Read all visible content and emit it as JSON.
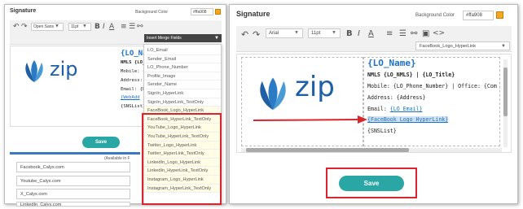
{
  "left": {
    "title": "Signature",
    "bg_label": "Background Color",
    "bg_value": "#ffa908",
    "toolbar": {
      "font": "Open Sans",
      "size": "11pt",
      "merge_label": "Insert Merge Fields"
    },
    "sig": {
      "name": "{LO_Nam",
      "nmls": "NMLS {LO_N",
      "mobile": "Mobile: {LO_",
      "address": "Address: {Ad",
      "email": "Email: {LO_",
      "web": "{WebAdd",
      "sns": "{SNSList}"
    },
    "dropdown_items": [
      "LO_Email",
      "Sender_Email",
      "LO_Phone_Number",
      "Profile_Image",
      "Sender_Name",
      "SignIn_HyperLink",
      "SignIn_HyperLink_TextOnly",
      "FaceBook_Logo_HyperLink",
      "FaceBook_HyperLink_TextOnly",
      "YouTube_Logo_HyperLink",
      "YouTube_HyperLink_TextOnly",
      "Twitter_Logo_HyperLink",
      "Twitter_HyperLink_TextOnly",
      "LinkedIn_Logo_HyperLink",
      "LinkedIn_HyperLink_TextOnly",
      "Instagram_Logo_HyperLink",
      "Instagram_HyperLink_TextOnly"
    ],
    "save": "Save",
    "available": "(Available in F",
    "social_fields": [
      "Facebook_Calyx.com",
      "Youtube_Calyx.com",
      "X_Calyx.com",
      "LinkedIn_Calyx.com"
    ]
  },
  "right": {
    "title": "Signature",
    "bg_label": "Background Color",
    "bg_value": "#ffa908",
    "toolbar": {
      "font": "Arial",
      "size": "11pt",
      "merge_value": "FaceBook_Logo_HyperLink"
    },
    "logo_text": "zip",
    "sig": {
      "name": "{LO_Name}",
      "nmls": "NMLS {LO_NMLS} | {LO_Title}",
      "mobile": "Mobile: {LO_Phone_Number} | Office: {Com",
      "address": "Address: {Address}",
      "email_label": "Email: ",
      "email_value": "{LO_Email}",
      "fb": "{FaceBook_Logo_HyperLink}",
      "sns": "{SNSList}"
    },
    "save": "Save"
  },
  "colors": {
    "accent": "#2aa6a4",
    "highlight": "#d9262e",
    "swatch": "#f5a623",
    "link": "#1a73c8"
  }
}
